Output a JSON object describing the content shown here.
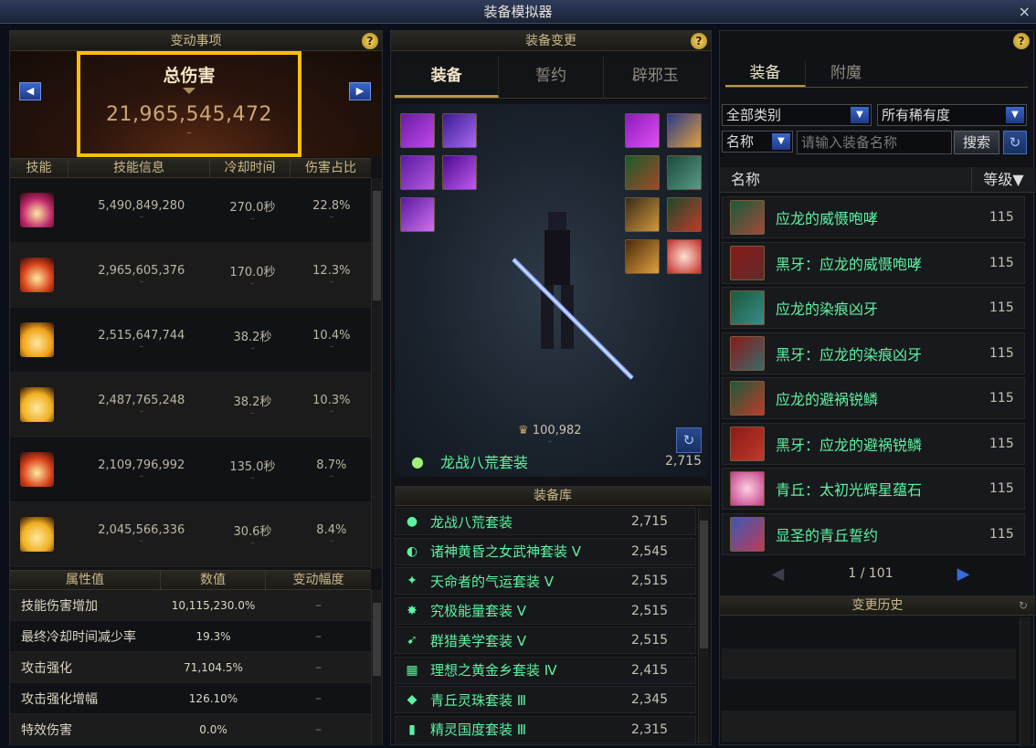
{
  "window": {
    "title": "装备模拟器",
    "close": "×"
  },
  "left": {
    "header": "变动事项",
    "help": "?",
    "damage": {
      "label": "总伤害",
      "value": "21,965,545,472",
      "delta": "–"
    },
    "prev": "◀",
    "next": "▶",
    "columns": [
      "技能",
      "技能信息",
      "冷却时间",
      "伤害占比"
    ],
    "skills": [
      {
        "damage": "5,490,849,280",
        "cooldown": "270.0秒",
        "ratio": "22.8%",
        "icon": "skill-icon-1",
        "color": "#c0286c"
      },
      {
        "damage": "2,965,605,376",
        "cooldown": "170.0秒",
        "ratio": "12.3%",
        "icon": "skill-icon-2",
        "color": "#d8401a"
      },
      {
        "damage": "2,515,647,744",
        "cooldown": "38.2秒",
        "ratio": "10.4%",
        "icon": "skill-icon-3",
        "color": "#f0a21a"
      },
      {
        "damage": "2,487,765,248",
        "cooldown": "38.2秒",
        "ratio": "10.3%",
        "icon": "skill-icon-4",
        "color": "#f0b020"
      },
      {
        "damage": "2,109,796,992",
        "cooldown": "135.0秒",
        "ratio": "8.7%",
        "icon": "skill-icon-5",
        "color": "#d8401a"
      },
      {
        "damage": "2,045,566,336",
        "cooldown": "30.6秒",
        "ratio": "8.4%",
        "icon": "skill-icon-6",
        "color": "#f0b020"
      }
    ],
    "dash": "–",
    "attr_columns": [
      "属性值",
      "数值",
      "变动幅度"
    ],
    "attributes": [
      {
        "name": "技能伤害增加",
        "value": "10,115,230.0%",
        "change": "–"
      },
      {
        "name": "最终冷却时间减少率",
        "value": "19.3%",
        "change": "–"
      },
      {
        "name": "攻击强化",
        "value": "71,104.5%",
        "change": "–"
      },
      {
        "name": "攻击强化增幅",
        "value": "126.10%",
        "change": "–"
      },
      {
        "name": "特效伤害",
        "value": "0.0%",
        "change": "–"
      }
    ]
  },
  "middle": {
    "header": "装备变更",
    "help": "?",
    "tabs": [
      "装备",
      "誓约",
      "辟邪玉"
    ],
    "score": "100,982",
    "score_delta": "–",
    "current_set": {
      "name": "龙战八荒套装",
      "value": "2,715"
    },
    "library_header": "装备库",
    "library": [
      {
        "name": "龙战八荒套装",
        "value": "2,715",
        "icon": "●"
      },
      {
        "name": "诸神黄昏之女武神套装 Ⅴ",
        "value": "2,545",
        "icon": "◐"
      },
      {
        "name": "天命者的气运套装 Ⅴ",
        "value": "2,515",
        "icon": "✦"
      },
      {
        "name": "究极能量套装 Ⅴ",
        "value": "2,515",
        "icon": "✸"
      },
      {
        "name": "群猎美学套装 Ⅴ",
        "value": "2,515",
        "icon": "➹"
      },
      {
        "name": "理想之黄金乡套装 Ⅳ",
        "value": "2,415",
        "icon": "▦"
      },
      {
        "name": "青丘灵珠套装 Ⅲ",
        "value": "2,345",
        "icon": "◆"
      },
      {
        "name": "精灵国度套装 Ⅲ",
        "value": "2,315",
        "icon": "▮"
      }
    ]
  },
  "right": {
    "help": "?",
    "tabs": [
      "装备",
      "附魔"
    ],
    "filter_category": "全部类别",
    "filter_rarity": "所有稀有度",
    "filter_field": "名称",
    "search_placeholder": "请输入装备名称",
    "search_button": "搜索",
    "list_columns": [
      "名称",
      "等级▼"
    ],
    "items": [
      {
        "name": "应龙的威慑咆哮",
        "level": "115"
      },
      {
        "name": "黑牙：应龙的威慑咆哮",
        "level": "115"
      },
      {
        "name": "应龙的染痕凶牙",
        "level": "115"
      },
      {
        "name": "黑牙：应龙的染痕凶牙",
        "level": "115"
      },
      {
        "name": "应龙的避祸锐鳞",
        "level": "115"
      },
      {
        "name": "黑牙：应龙的避祸锐鳞",
        "level": "115"
      },
      {
        "name": "青丘：太初光辉星蕴石",
        "level": "115"
      },
      {
        "name": "显圣的青丘誓约",
        "level": "115"
      }
    ],
    "pager": "1 / 101",
    "history_header": "变更历史"
  }
}
